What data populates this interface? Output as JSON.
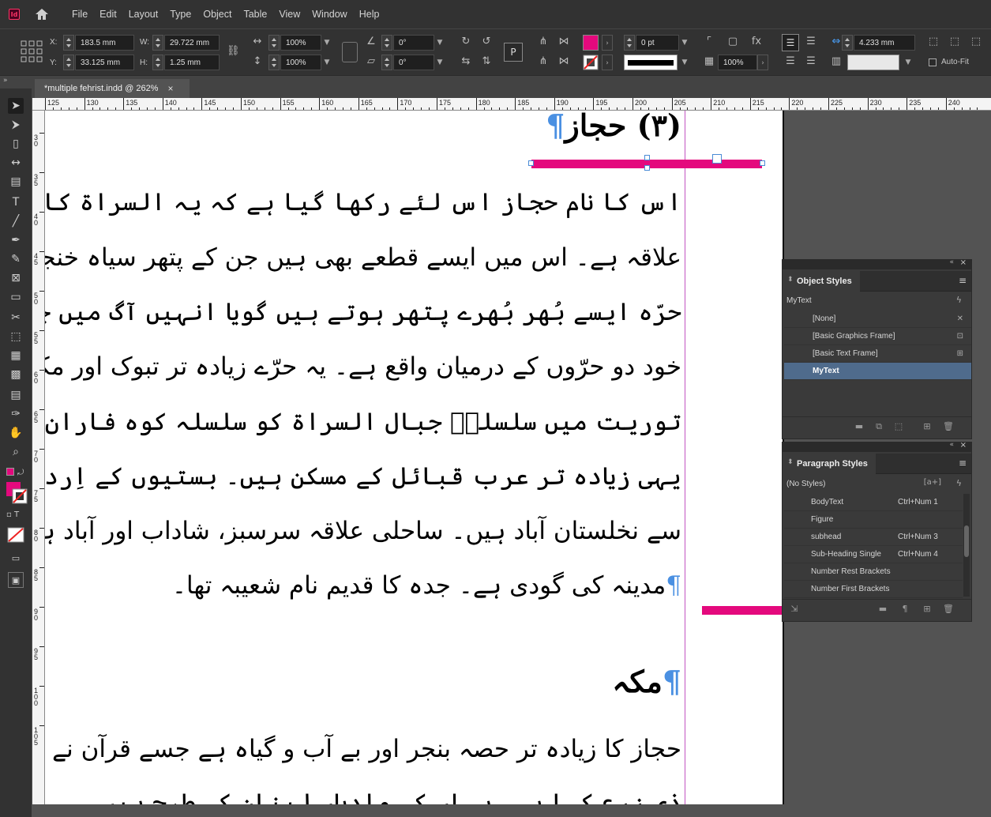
{
  "app": {
    "logo": "Id"
  },
  "menu": [
    "File",
    "Edit",
    "Layout",
    "Type",
    "Object",
    "Table",
    "View",
    "Window",
    "Help"
  ],
  "control": {
    "x_label": "X:",
    "x": "183.5 mm",
    "y_label": "Y:",
    "y": "33.125 mm",
    "w_label": "W:",
    "w": "29.722 mm",
    "h_label": "H:",
    "h": "1.25 mm",
    "scale_x": "100%",
    "scale_y": "100%",
    "angle": "0°",
    "shear": "0°",
    "stroke_weight": "0 pt",
    "opacity": "100%",
    "gutter": "4.233 mm",
    "autofit": "Auto-Fit",
    "fill_color": "#e4097d"
  },
  "doc_tab": {
    "title": "*multiple fehrist.indd @ 262%",
    "close": "×"
  },
  "ruler": {
    "h": [
      "125",
      "130",
      "135",
      "140",
      "145",
      "150",
      "155",
      "160",
      "165",
      "170",
      "175",
      "180",
      "185",
      "190",
      "195",
      "200",
      "205",
      "210",
      "215",
      "220",
      "225",
      "230",
      "235",
      "240"
    ],
    "v": [
      "30",
      "35",
      "40",
      "45",
      "50",
      "55",
      "60",
      "65",
      "70",
      "75",
      "80",
      "85",
      "90",
      "95",
      "100",
      "105"
    ]
  },
  "page": {
    "title": "(٣) حجاز",
    "lines": [
      "اس کا نام حجاز اس لئے رکھا گیا ہے کہ یہ السراۃ کا کوہستانی سلسلہ ہے",
      "علاقہ ہے۔ اس میں ایسے قطعے بھی ہیں جن کے پتھر سیاہ خنجر کی طرح ہیں۔ ان",
      "حرّہ ایسے بُھر بُھرے پتھر ہوتے ہیں گویا انہیں آگ میں جلا دیا گیا ہو",
      "خود دو حرّوں کے درمیان واقع ہے۔ یہ حرّے زیادہ تر تبوک اور مکہ کے درمیان",
      "توریت میں سلسلہٗ جبال السراۃ کو سلسلہ کوہ فاران کا نام دیا گیا ہے",
      "یہی زیادہ تر عرب قبائل کے مسکن ہیں۔ بستیوں کے اِرد گرد ان کے کھیت ہو",
      "سے نخلستان آباد ہیں۔ ساحلی علاقہ سرسبز، شاداب اور آباد ہے۔ دامن کوہ میں",
      "مدینہ کی گودی ہے۔ جدہ کا قدیم نام شعیبہ تھا۔"
    ],
    "subtitle": "مکہ",
    "lines2": [
      "حجاز کا زیادہ تر حصہ بنجر اور بے آب و گیاہ ہے جسے قرآن نے ”وادی غیر",
      "ذی زرع کہا ہے۔ یہاں کی وادیاں لبنان کی طرح ہیں"
    ],
    "pilcrow": "¶"
  },
  "object_styles": {
    "title": "Object Styles",
    "current": "MyText",
    "items": [
      "[None]",
      "[Basic Graphics Frame]",
      "[Basic Text Frame]",
      "MyText"
    ],
    "selected": "MyText"
  },
  "paragraph_styles": {
    "title": "Paragraph Styles",
    "current": "(No Styles)",
    "current_icon": "[a+]",
    "items": [
      {
        "name": "BodyText",
        "shortcut": "Ctrl+Num 1"
      },
      {
        "name": "Figure",
        "shortcut": ""
      },
      {
        "name": "subhead",
        "shortcut": "Ctrl+Num 3"
      },
      {
        "name": "Sub-Heading Single",
        "shortcut": "Ctrl+Num 4"
      },
      {
        "name": "Number Rest Brackets",
        "shortcut": ""
      },
      {
        "name": "Number First Brackets",
        "shortcut": ""
      }
    ]
  }
}
